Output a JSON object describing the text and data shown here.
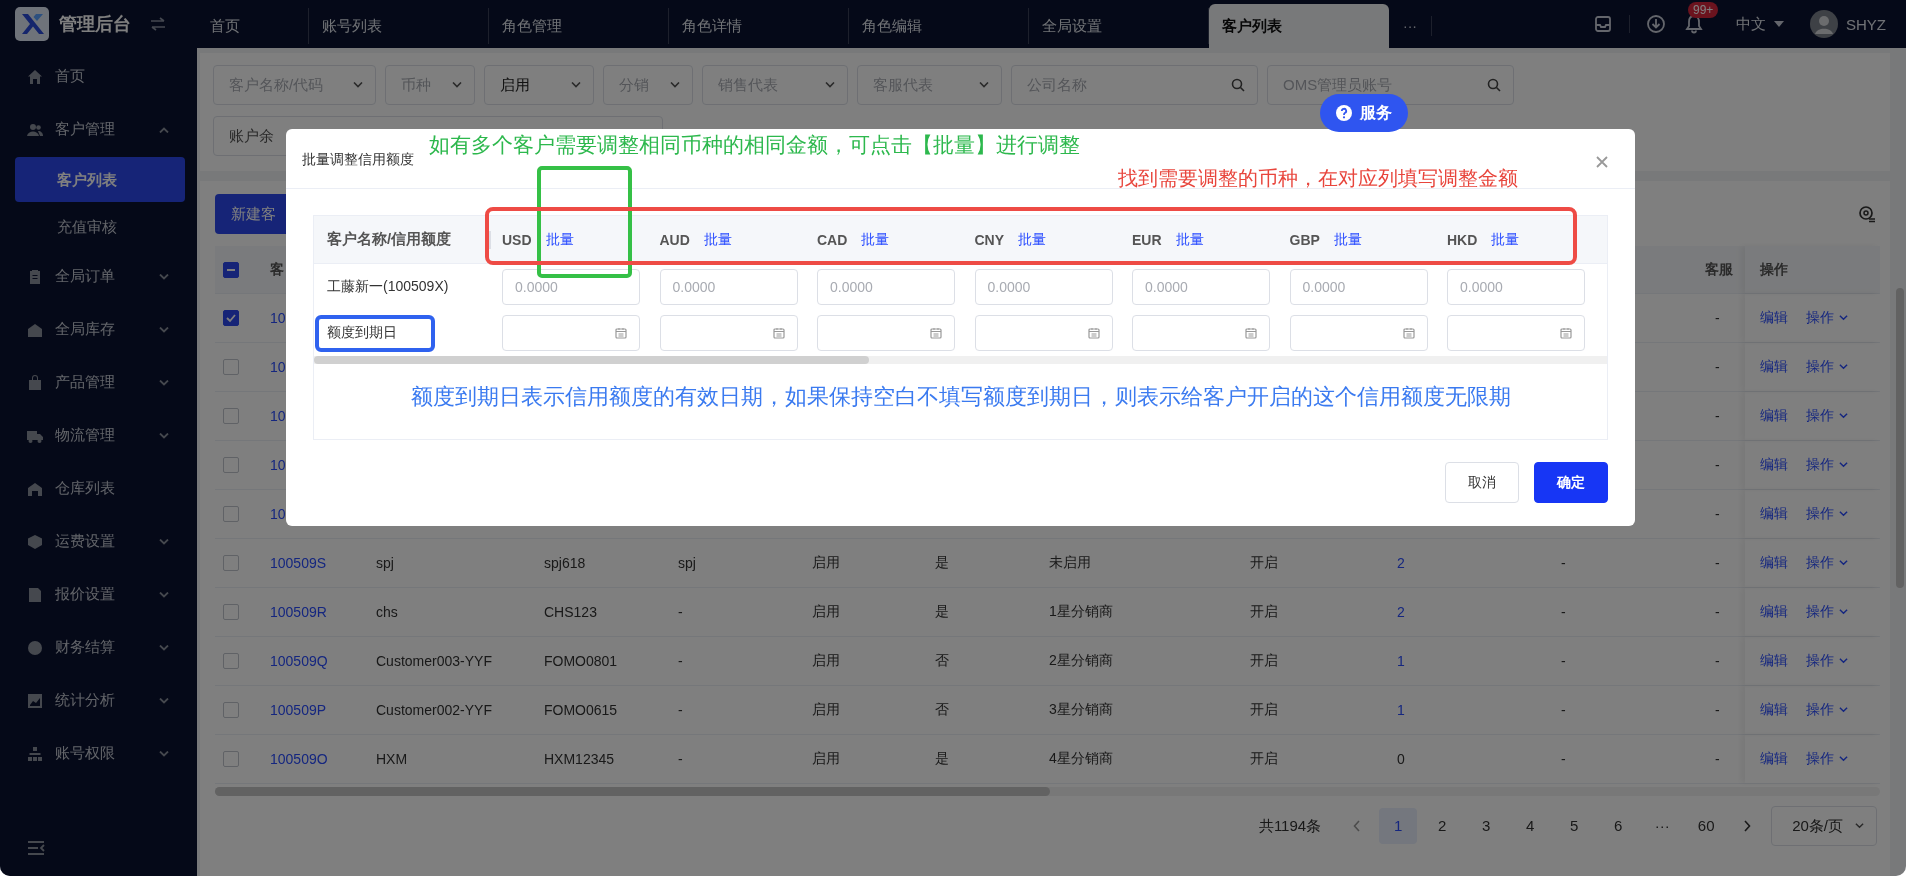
{
  "brand": {
    "title": "管理后台"
  },
  "tabs": [
    {
      "label": "首页",
      "selected": false
    },
    {
      "label": "账号列表",
      "selected": false
    },
    {
      "label": "角色管理",
      "selected": false
    },
    {
      "label": "角色详情",
      "selected": false
    },
    {
      "label": "角色编辑",
      "selected": false
    },
    {
      "label": "全局设置",
      "selected": false
    },
    {
      "label": "客户列表",
      "selected": true
    }
  ],
  "tabs_more": "···",
  "header": {
    "badge": "99+",
    "language": "中文",
    "user": "SHYZ"
  },
  "sidebar": {
    "items": [
      {
        "label": "首页",
        "kind": "link"
      },
      {
        "label": "客户管理",
        "kind": "group",
        "expanded": true,
        "children": [
          {
            "label": "客户列表",
            "selected": true
          },
          {
            "label": "充值审核",
            "selected": false
          }
        ]
      },
      {
        "label": "全局订单",
        "kind": "group",
        "expanded": false
      },
      {
        "label": "全局库存",
        "kind": "group",
        "expanded": false
      },
      {
        "label": "产品管理",
        "kind": "group",
        "expanded": false
      },
      {
        "label": "物流管理",
        "kind": "group",
        "expanded": false
      },
      {
        "label": "仓库列表",
        "kind": "link"
      },
      {
        "label": "运费设置",
        "kind": "group",
        "expanded": false
      },
      {
        "label": "报价设置",
        "kind": "group",
        "expanded": false
      },
      {
        "label": "财务结算",
        "kind": "group",
        "expanded": false
      },
      {
        "label": "统计分析",
        "kind": "group",
        "expanded": false
      },
      {
        "label": "账号权限",
        "kind": "group",
        "expanded": false
      }
    ]
  },
  "filters": [
    {
      "kind": "select",
      "placeholder": "客户名称/代码"
    },
    {
      "kind": "select",
      "placeholder": "币种"
    },
    {
      "kind": "select",
      "value": "启用"
    },
    {
      "kind": "select",
      "placeholder": "分销"
    },
    {
      "kind": "select",
      "placeholder": "销售代表"
    },
    {
      "kind": "select",
      "placeholder": "客服代表"
    },
    {
      "kind": "search",
      "placeholder": "公司名称"
    },
    {
      "kind": "search",
      "placeholder": "OMS管理员账号"
    }
  ],
  "filters_row2": {
    "label": "账户余"
  },
  "toolbar": {
    "new_button": "新建客"
  },
  "table": {
    "header": {
      "select_all_indeterminate": true,
      "column_1": "客",
      "column_11": "客服",
      "actions": "操作"
    },
    "rows": [
      {
        "checked": true,
        "id": "10",
        "col_11": "-",
        "edit": "编辑",
        "more": "操作"
      },
      {
        "checked": false,
        "id": "10",
        "col_11": "-",
        "edit": "编辑",
        "more": "操作"
      },
      {
        "checked": false,
        "id": "10",
        "col_11": "-",
        "edit": "编辑",
        "more": "操作"
      },
      {
        "checked": false,
        "id": "10",
        "col_11": "-",
        "edit": "编辑",
        "more": "操作"
      },
      {
        "checked": false,
        "id": "10",
        "col_11": "-",
        "edit": "编辑",
        "more": "操作"
      },
      {
        "checked": false,
        "id": "100509S",
        "name": "spj",
        "code": "spj618",
        "col_4": "spj",
        "status": "启用",
        "col_6": "是",
        "level": "未启用",
        "col_8": "开启",
        "count": "2",
        "count_link": true,
        "col_10": "-",
        "col_11": "-",
        "edit": "编辑",
        "more": "操作"
      },
      {
        "checked": false,
        "id": "100509R",
        "name": "chs",
        "code": "CHS123",
        "col_4": "-",
        "status": "启用",
        "col_6": "是",
        "level": "1星分销商",
        "col_8": "开启",
        "count": "2",
        "count_link": true,
        "col_10": "-",
        "col_11": "-",
        "edit": "编辑",
        "more": "操作"
      },
      {
        "checked": false,
        "id": "100509Q",
        "name": "Customer003-YYF",
        "code": "FOMO0801",
        "col_4": "-",
        "status": "启用",
        "col_6": "否",
        "level": "2星分销商",
        "col_8": "开启",
        "count": "1",
        "count_link": true,
        "col_10": "-",
        "col_11": "-",
        "edit": "编辑",
        "more": "操作"
      },
      {
        "checked": false,
        "id": "100509P",
        "name": "Customer002-YYF",
        "code": "FOMO0615",
        "col_4": "-",
        "status": "启用",
        "col_6": "否",
        "level": "3星分销商",
        "col_8": "开启",
        "count": "1",
        "count_link": true,
        "col_10": "-",
        "col_11": "-",
        "edit": "编辑",
        "more": "操作"
      },
      {
        "checked": false,
        "id": "100509O",
        "name": "HXM",
        "code": "HXM12345",
        "col_4": "-",
        "status": "启用",
        "col_6": "是",
        "level": "4星分销商",
        "col_8": "开启",
        "count": "0",
        "count_link": false,
        "col_10": "-",
        "col_11": "-",
        "edit": "编辑",
        "more": "操作"
      }
    ]
  },
  "pagination": {
    "total": "共1194条",
    "pages": [
      {
        "label": "1",
        "selected": true
      },
      {
        "label": "2",
        "selected": false
      },
      {
        "label": "3",
        "selected": false
      },
      {
        "label": "4",
        "selected": false
      },
      {
        "label": "5",
        "selected": false
      },
      {
        "label": "6",
        "selected": false
      },
      {
        "label": "···",
        "selected": false
      },
      {
        "label": "60",
        "selected": false
      }
    ],
    "page_size": "20条/页"
  },
  "service_button": "服务",
  "modal": {
    "title": "批量调整信用额度",
    "first_column": "客户名称/信用额度",
    "currencies": [
      {
        "code": "USD",
        "batch": "批量",
        "amount_placeholder": "0.0000"
      },
      {
        "code": "AUD",
        "batch": "批量",
        "amount_placeholder": "0.0000"
      },
      {
        "code": "CAD",
        "batch": "批量",
        "amount_placeholder": "0.0000"
      },
      {
        "code": "CNY",
        "batch": "批量",
        "amount_placeholder": "0.0000"
      },
      {
        "code": "EUR",
        "batch": "批量",
        "amount_placeholder": "0.0000"
      },
      {
        "code": "GBP",
        "batch": "批量",
        "amount_placeholder": "0.0000"
      },
      {
        "code": "HKD",
        "batch": "批量",
        "amount_placeholder": "0.0000"
      }
    ],
    "customer_label": "工藤新一(100509X)",
    "expiry_label": "额度到期日",
    "batch_hint": "如有多个客户需要调整相同币种的相同金额，可点击【批量】进行调整",
    "column_hint": "找到需要调整的币种，在对应列填写调整金额",
    "expiry_hint": "额度到期日表示信用额度的有效日期，如果保持空白不填写额度到期日，则表示给客户开启的这个信用额度无限期",
    "cancel": "取消",
    "confirm": "确定"
  }
}
